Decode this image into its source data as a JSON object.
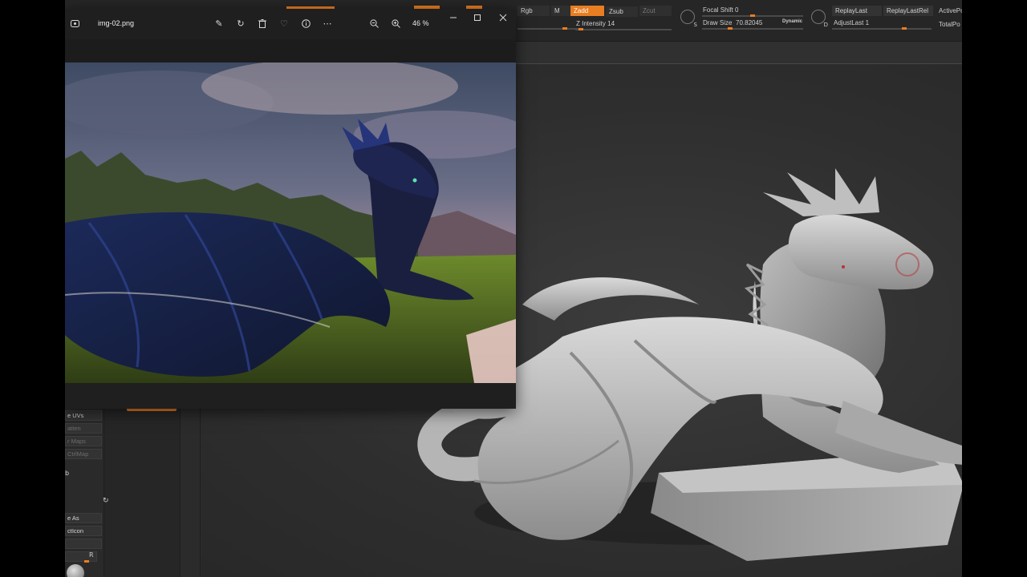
{
  "zbrush": {
    "top": {
      "rgb_label": "Rgb",
      "m_label": "M",
      "zadd_label": "Zadd",
      "zsub_label": "Zsub",
      "zcut_label": "Zcut",
      "z_intensity": "Z Intensity 14",
      "focal_shift": "Focal Shift 0",
      "draw_size": "Draw Size",
      "draw_size_value": "70.82045",
      "dynamic_label": "Dynamic",
      "replay_last": "ReplayLast",
      "replay_last_rel": "ReplayLastRel",
      "adjust_last": "AdjustLast 1",
      "active_points": "ActivePo",
      "total_points": "TotalPo",
      "s_label": "S",
      "d_label": "D"
    },
    "left_panel": {
      "uvs": "e UVs",
      "flatten": "atten",
      "maps": "r Maps",
      "ctrl_map": "CtrlMap",
      "b_label": "b",
      "save_as": "e As",
      "project_icon": "ctIcon",
      "r_label": "R"
    }
  },
  "viewer": {
    "title": "img-02.png",
    "zoom": "46 %",
    "icons": [
      "photo-app-icon",
      "edit-icon",
      "rotate-icon",
      "delete-icon",
      "favorite-icon",
      "info-icon",
      "more-icon",
      "zoom-out-icon",
      "zoom-in-icon",
      "minimize-icon",
      "maximize-icon",
      "close-icon"
    ]
  },
  "colors": {
    "accent": "#e87d21",
    "sky_top": "#3e4a63",
    "dragon_blue": "#1c2a5a",
    "grass": "#4f6e1f"
  }
}
